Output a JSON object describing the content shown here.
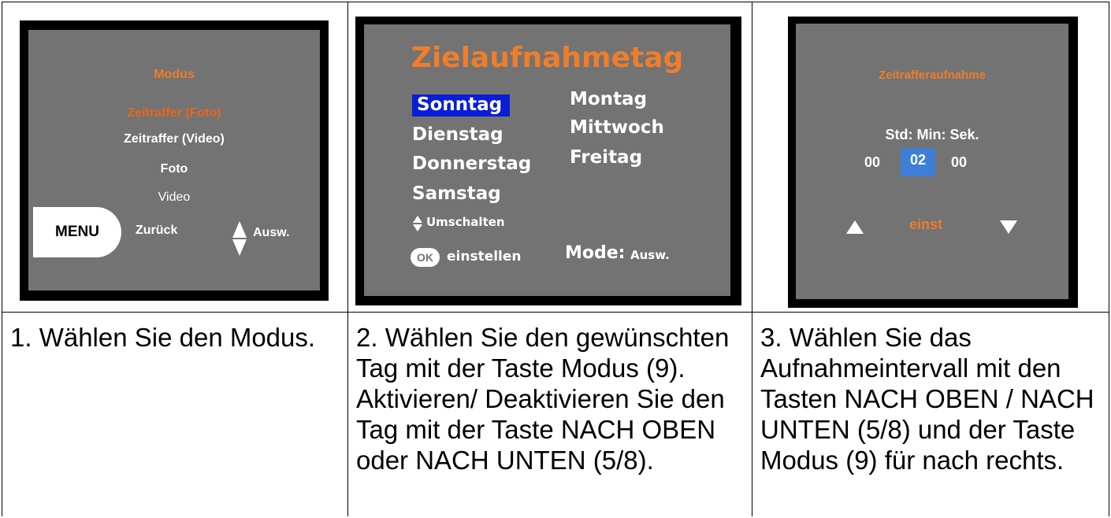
{
  "panel1": {
    "title": "Modus",
    "options": [
      "Zeitraffer (Foto)",
      "Zeitraffer (Video)",
      "Foto",
      "Video"
    ],
    "menu_label": "MENU",
    "back_label": "Zurück",
    "select_label": "Ausw.",
    "caption": "1. Wählen Sie den Modus."
  },
  "panel2": {
    "title": "Zielaufnahmetag",
    "days": [
      "Sonntag",
      "Montag",
      "Dienstag",
      "Mittwoch",
      "Donnerstag",
      "Freitag",
      "Samstag"
    ],
    "toggle_label": "Umschalten",
    "ok_label": "OK",
    "set_label": "einstellen",
    "mode_label": "Mode:",
    "mode_select": "Ausw.",
    "caption": "2. Wählen Sie den gewünschten Tag mit der Taste Modus (9). Aktivieren/ Deaktivieren Sie den Tag mit der Taste NACH OBEN oder NACH UNTEN (5/8)."
  },
  "panel3": {
    "title": "Zeitrafferaufnahme",
    "units": "Std: Min: Sek.",
    "hours": "00",
    "minutes": "02",
    "seconds": "00",
    "set_label": "einst",
    "caption": "3. Wählen Sie das Aufnahmeintervall mit den Tasten NACH OBEN / NACH UNTEN (5/8) und der Taste Modus (9) für nach rechts."
  },
  "colors": {
    "screen_gray": "#737373",
    "accent_orange": "#f07d2a",
    "selection_blue": "#0a1dd6",
    "field_blue": "#3d7fd6"
  }
}
